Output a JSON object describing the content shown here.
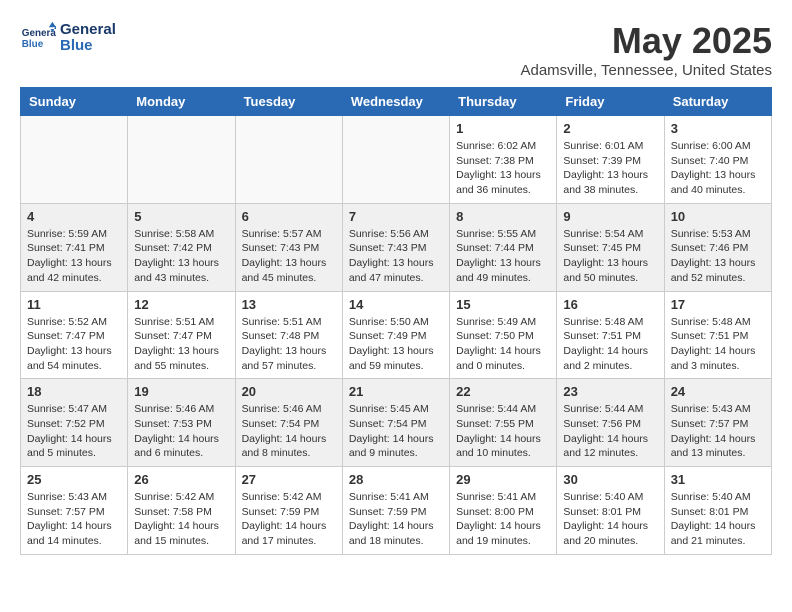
{
  "logo": {
    "text_general": "General",
    "text_blue": "Blue"
  },
  "title": "May 2025",
  "location": "Adamsville, Tennessee, United States",
  "days_of_week": [
    "Sunday",
    "Monday",
    "Tuesday",
    "Wednesday",
    "Thursday",
    "Friday",
    "Saturday"
  ],
  "weeks": [
    [
      {
        "day": "",
        "info": ""
      },
      {
        "day": "",
        "info": ""
      },
      {
        "day": "",
        "info": ""
      },
      {
        "day": "",
        "info": ""
      },
      {
        "day": "1",
        "info": "Sunrise: 6:02 AM\nSunset: 7:38 PM\nDaylight: 13 hours\nand 36 minutes."
      },
      {
        "day": "2",
        "info": "Sunrise: 6:01 AM\nSunset: 7:39 PM\nDaylight: 13 hours\nand 38 minutes."
      },
      {
        "day": "3",
        "info": "Sunrise: 6:00 AM\nSunset: 7:40 PM\nDaylight: 13 hours\nand 40 minutes."
      }
    ],
    [
      {
        "day": "4",
        "info": "Sunrise: 5:59 AM\nSunset: 7:41 PM\nDaylight: 13 hours\nand 42 minutes."
      },
      {
        "day": "5",
        "info": "Sunrise: 5:58 AM\nSunset: 7:42 PM\nDaylight: 13 hours\nand 43 minutes."
      },
      {
        "day": "6",
        "info": "Sunrise: 5:57 AM\nSunset: 7:43 PM\nDaylight: 13 hours\nand 45 minutes."
      },
      {
        "day": "7",
        "info": "Sunrise: 5:56 AM\nSunset: 7:43 PM\nDaylight: 13 hours\nand 47 minutes."
      },
      {
        "day": "8",
        "info": "Sunrise: 5:55 AM\nSunset: 7:44 PM\nDaylight: 13 hours\nand 49 minutes."
      },
      {
        "day": "9",
        "info": "Sunrise: 5:54 AM\nSunset: 7:45 PM\nDaylight: 13 hours\nand 50 minutes."
      },
      {
        "day": "10",
        "info": "Sunrise: 5:53 AM\nSunset: 7:46 PM\nDaylight: 13 hours\nand 52 minutes."
      }
    ],
    [
      {
        "day": "11",
        "info": "Sunrise: 5:52 AM\nSunset: 7:47 PM\nDaylight: 13 hours\nand 54 minutes."
      },
      {
        "day": "12",
        "info": "Sunrise: 5:51 AM\nSunset: 7:47 PM\nDaylight: 13 hours\nand 55 minutes."
      },
      {
        "day": "13",
        "info": "Sunrise: 5:51 AM\nSunset: 7:48 PM\nDaylight: 13 hours\nand 57 minutes."
      },
      {
        "day": "14",
        "info": "Sunrise: 5:50 AM\nSunset: 7:49 PM\nDaylight: 13 hours\nand 59 minutes."
      },
      {
        "day": "15",
        "info": "Sunrise: 5:49 AM\nSunset: 7:50 PM\nDaylight: 14 hours\nand 0 minutes."
      },
      {
        "day": "16",
        "info": "Sunrise: 5:48 AM\nSunset: 7:51 PM\nDaylight: 14 hours\nand 2 minutes."
      },
      {
        "day": "17",
        "info": "Sunrise: 5:48 AM\nSunset: 7:51 PM\nDaylight: 14 hours\nand 3 minutes."
      }
    ],
    [
      {
        "day": "18",
        "info": "Sunrise: 5:47 AM\nSunset: 7:52 PM\nDaylight: 14 hours\nand 5 minutes."
      },
      {
        "day": "19",
        "info": "Sunrise: 5:46 AM\nSunset: 7:53 PM\nDaylight: 14 hours\nand 6 minutes."
      },
      {
        "day": "20",
        "info": "Sunrise: 5:46 AM\nSunset: 7:54 PM\nDaylight: 14 hours\nand 8 minutes."
      },
      {
        "day": "21",
        "info": "Sunrise: 5:45 AM\nSunset: 7:54 PM\nDaylight: 14 hours\nand 9 minutes."
      },
      {
        "day": "22",
        "info": "Sunrise: 5:44 AM\nSunset: 7:55 PM\nDaylight: 14 hours\nand 10 minutes."
      },
      {
        "day": "23",
        "info": "Sunrise: 5:44 AM\nSunset: 7:56 PM\nDaylight: 14 hours\nand 12 minutes."
      },
      {
        "day": "24",
        "info": "Sunrise: 5:43 AM\nSunset: 7:57 PM\nDaylight: 14 hours\nand 13 minutes."
      }
    ],
    [
      {
        "day": "25",
        "info": "Sunrise: 5:43 AM\nSunset: 7:57 PM\nDaylight: 14 hours\nand 14 minutes."
      },
      {
        "day": "26",
        "info": "Sunrise: 5:42 AM\nSunset: 7:58 PM\nDaylight: 14 hours\nand 15 minutes."
      },
      {
        "day": "27",
        "info": "Sunrise: 5:42 AM\nSunset: 7:59 PM\nDaylight: 14 hours\nand 17 minutes."
      },
      {
        "day": "28",
        "info": "Sunrise: 5:41 AM\nSunset: 7:59 PM\nDaylight: 14 hours\nand 18 minutes."
      },
      {
        "day": "29",
        "info": "Sunrise: 5:41 AM\nSunset: 8:00 PM\nDaylight: 14 hours\nand 19 minutes."
      },
      {
        "day": "30",
        "info": "Sunrise: 5:40 AM\nSunset: 8:01 PM\nDaylight: 14 hours\nand 20 minutes."
      },
      {
        "day": "31",
        "info": "Sunrise: 5:40 AM\nSunset: 8:01 PM\nDaylight: 14 hours\nand 21 minutes."
      }
    ]
  ]
}
